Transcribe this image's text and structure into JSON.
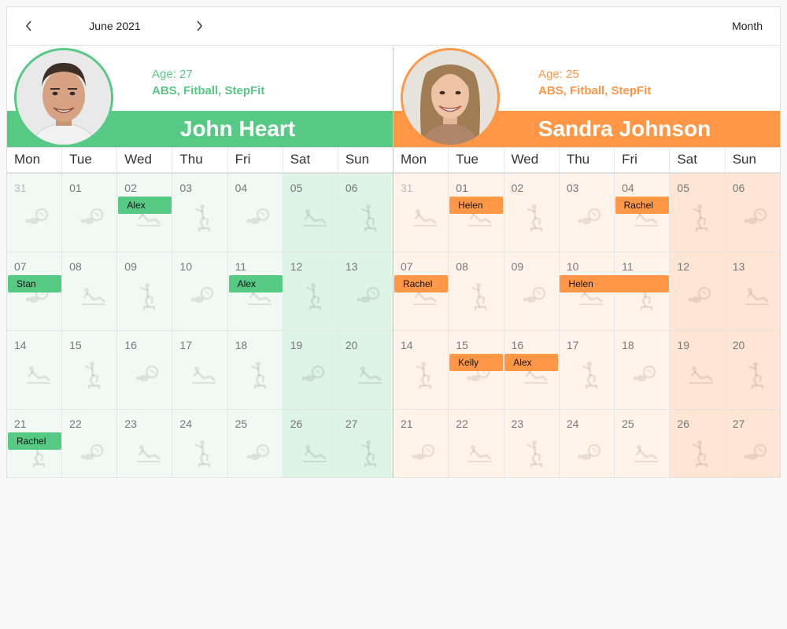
{
  "toolbar": {
    "period_label": "June 2021",
    "view_label": "Month",
    "prev_icon": "chevron-left-icon",
    "next_icon": "chevron-right-icon"
  },
  "day_names": [
    "Mon",
    "Tue",
    "Wed",
    "Thu",
    "Fri",
    "Sat",
    "Sun"
  ],
  "resources": [
    {
      "name": "John Heart",
      "age": "Age: 27",
      "skills": "ABS, Fitball, StepFit",
      "color": "#56ca85",
      "text_color": "#56ca85",
      "cell_bg": "#f1f9f4",
      "weekend_bg": "#ddf4e6",
      "avatar_icon": "man-portrait-photo",
      "weeks": [
        [
          "31",
          "01",
          "02",
          "03",
          "04",
          "05",
          "06"
        ],
        [
          "07",
          "08",
          "09",
          "10",
          "11",
          "12",
          "13"
        ],
        [
          "14",
          "15",
          "16",
          "17",
          "18",
          "19",
          "20"
        ],
        [
          "21",
          "22",
          "23",
          "24",
          "25",
          "26",
          "27"
        ]
      ],
      "icons": [
        [
          "fitball",
          "fitball",
          "abs",
          "stepfit",
          "fitball",
          "abs",
          "stepfit"
        ],
        [
          "fitball",
          "abs",
          "stepfit",
          "fitball",
          "abs",
          "stepfit",
          "fitball"
        ],
        [
          "abs",
          "stepfit",
          "fitball",
          "abs",
          "stepfit",
          "fitball",
          "abs"
        ],
        [
          "stepfit",
          "fitball",
          "abs",
          "stepfit",
          "fitball",
          "abs",
          "stepfit"
        ]
      ],
      "events": [
        {
          "title": "Alex",
          "week": 0,
          "day": 2,
          "span": 1
        },
        {
          "title": "Stan",
          "week": 1,
          "day": 0,
          "span": 1
        },
        {
          "title": "Alex",
          "week": 1,
          "day": 4,
          "span": 1
        },
        {
          "title": "Rachel",
          "week": 3,
          "day": 0,
          "span": 1
        }
      ]
    },
    {
      "name": "Sandra Johnson",
      "age": "Age: 25",
      "skills": "ABS, Fitball, StepFit",
      "color": "#ff9747",
      "text_color": "#ff9747",
      "cell_bg": "#fff3ea",
      "weekend_bg": "#ffe6d4",
      "avatar_icon": "woman-portrait-photo",
      "weeks": [
        [
          "31",
          "01",
          "02",
          "03",
          "04",
          "05",
          "06"
        ],
        [
          "07",
          "08",
          "09",
          "10",
          "11",
          "12",
          "13"
        ],
        [
          "14",
          "15",
          "16",
          "17",
          "18",
          "19",
          "20"
        ],
        [
          "21",
          "22",
          "23",
          "24",
          "25",
          "26",
          "27"
        ]
      ],
      "icons": [
        [
          "abs",
          "abs",
          "stepfit",
          "fitball",
          "abs",
          "stepfit",
          "fitball"
        ],
        [
          "abs",
          "stepfit",
          "fitball",
          "abs",
          "stepfit",
          "fitball",
          "abs"
        ],
        [
          "stepfit",
          "fitball",
          "abs",
          "stepfit",
          "fitball",
          "abs",
          "stepfit"
        ],
        [
          "fitball",
          "abs",
          "stepfit",
          "fitball",
          "abs",
          "stepfit",
          "fitball"
        ]
      ],
      "events": [
        {
          "title": "Helen",
          "week": 0,
          "day": 1,
          "span": 1
        },
        {
          "title": "Rachel",
          "week": 0,
          "day": 4,
          "span": 1
        },
        {
          "title": "Rachel",
          "week": 1,
          "day": 0,
          "span": 1
        },
        {
          "title": "Helen",
          "week": 1,
          "day": 3,
          "span": 2
        },
        {
          "title": "Kelly",
          "week": 2,
          "day": 1,
          "span": 1
        },
        {
          "title": "Alex",
          "week": 2,
          "day": 2,
          "span": 1
        }
      ]
    }
  ]
}
